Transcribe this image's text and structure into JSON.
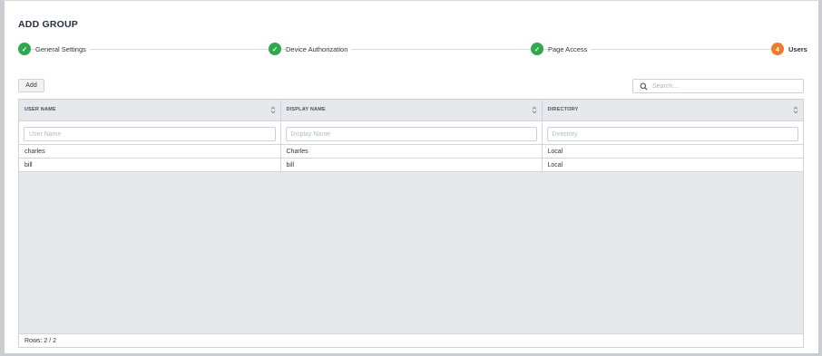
{
  "page": {
    "title": "ADD GROUP"
  },
  "stepper": {
    "steps": [
      {
        "label": "General Settings",
        "state": "done",
        "marker": "✓"
      },
      {
        "label": "Device Authorization",
        "state": "done",
        "marker": "✓"
      },
      {
        "label": "Page Access",
        "state": "done",
        "marker": "✓"
      },
      {
        "label": "Users",
        "state": "current",
        "marker": "4"
      }
    ],
    "colors": {
      "done": "#2fa84f",
      "current": "#f07b2b"
    }
  },
  "toolbar": {
    "add_label": "Add",
    "search": {
      "placeholder": "Search...",
      "value": "",
      "icon": "search-icon"
    }
  },
  "table": {
    "columns": [
      {
        "label": "USER NAME",
        "filter_placeholder": "User Name",
        "sort_icon": "sort-icon"
      },
      {
        "label": "DISPLAY NAME",
        "filter_placeholder": "Display Name",
        "sort_icon": "sort-icon"
      },
      {
        "label": "DIRECTORY",
        "filter_placeholder": "Directory",
        "sort_icon": "sort-icon"
      }
    ],
    "rows": [
      [
        "charles",
        "Charles",
        "Local"
      ],
      [
        "bill",
        "bill",
        "Local"
      ]
    ],
    "footer": "Rows: 2 / 2"
  }
}
